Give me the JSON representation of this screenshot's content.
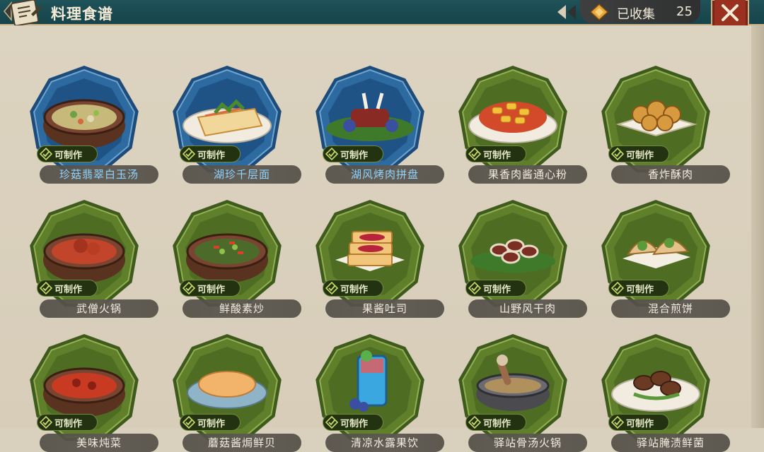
{
  "header": {
    "title": "料理食谱",
    "collected_label": "已收集",
    "collected_count": "25"
  },
  "colors": {
    "badge_blue": "#2c6aa0",
    "badge_green": "#5f7f2b",
    "craftable_bg": "#233311",
    "name_highlight": "#8fd3ff"
  },
  "recipes": [
    {
      "name": "珍菇翡翠白玉汤",
      "status": "可制作",
      "tier": "blue",
      "icon": "soup-bowl-icon"
    },
    {
      "name": "湖珍千层面",
      "status": "可制作",
      "tier": "blue",
      "icon": "lasagna-icon"
    },
    {
      "name": "湖风烤肉拼盘",
      "status": "可制作",
      "tier": "blue",
      "icon": "roast-platter-icon"
    },
    {
      "name": "果香肉酱通心粉",
      "status": "可制作",
      "tier": "green",
      "icon": "macaroni-icon"
    },
    {
      "name": "香炸酥肉",
      "status": "可制作",
      "tier": "green",
      "icon": "fried-pork-icon"
    },
    {
      "name": "武僧火锅",
      "status": "可制作",
      "tier": "green",
      "icon": "hotpot-icon"
    },
    {
      "name": "鲜酸素炒",
      "status": "可制作",
      "tier": "green",
      "icon": "stir-fry-icon"
    },
    {
      "name": "果酱吐司",
      "status": "可制作",
      "tier": "green",
      "icon": "jam-toast-icon"
    },
    {
      "name": "山野风干肉",
      "status": "可制作",
      "tier": "green",
      "icon": "dried-meat-icon"
    },
    {
      "name": "混合煎饼",
      "status": "可制作",
      "tier": "green",
      "icon": "wrap-pancake-icon"
    },
    {
      "name": "美味炖菜",
      "status": "可制作",
      "tier": "green",
      "icon": "stew-bowl-icon"
    },
    {
      "name": "蘑菇酱焗鲜贝",
      "status": "可制作",
      "tier": "green",
      "icon": "baked-scallop-icon"
    },
    {
      "name": "清凉水露果饮",
      "status": "可制作",
      "tier": "green",
      "icon": "fruit-drink-icon"
    },
    {
      "name": "驿站骨汤火锅",
      "status": "可制作",
      "tier": "green",
      "icon": "bone-broth-pot-icon"
    },
    {
      "name": "驿站腌渍鲜菌",
      "status": "可制作",
      "tier": "green",
      "icon": "pickled-mushroom-icon"
    }
  ]
}
